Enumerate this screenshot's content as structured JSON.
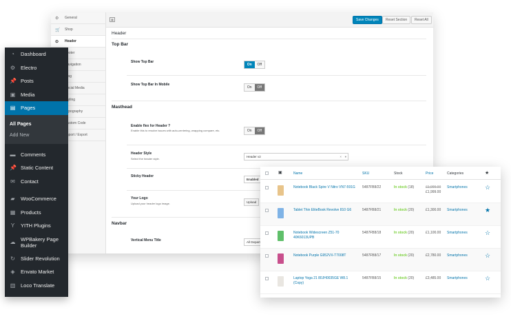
{
  "theme_options": {
    "nav": [
      {
        "icon": "gear-icon",
        "glyph": "⚙",
        "label": "General"
      },
      {
        "icon": "cart-icon",
        "glyph": "🛒",
        "label": "Shop"
      },
      {
        "icon": "header-icon",
        "glyph": "⊙",
        "label": "Header",
        "active": true
      },
      {
        "icon": "footer-icon",
        "glyph": "▢",
        "label": "Footer"
      },
      {
        "icon": "navigation-icon",
        "glyph": "≡",
        "label": "Navigation"
      },
      {
        "icon": "blog-icon",
        "glyph": "▤",
        "label": "Blog"
      },
      {
        "icon": "social-icon",
        "glyph": "◎",
        "label": "Social Media"
      },
      {
        "icon": "styling-icon",
        "glyph": "✎",
        "label": "Styling"
      },
      {
        "icon": "typography-icon",
        "glyph": "A",
        "label": "Typography"
      },
      {
        "icon": "code-icon",
        "glyph": "‹›",
        "label": "Custom Code"
      },
      {
        "icon": "import-icon",
        "glyph": "⇅",
        "label": "Import / Export"
      }
    ],
    "buttons": {
      "save": "Save Changes",
      "reset_section": "Reset Section",
      "reset_all": "Reset All"
    },
    "section_title": "Header",
    "top_bar": {
      "title": "Top Bar",
      "show_top_bar": {
        "label": "Show Top Bar",
        "on": "On",
        "off": "Off",
        "value": "On"
      },
      "show_top_bar_mobile": {
        "label": "Show Top Bar In Mobile",
        "on": "On",
        "off": "Off",
        "value": "Off"
      }
    },
    "masthead": {
      "title": "Masthead",
      "flex": {
        "label": "Enable flex for Header ?",
        "desc": "Enable this to resolve issues with auto-centering, wrapping compare, etc.",
        "on": "On",
        "off": "Off",
        "value": "Off"
      },
      "header_style": {
        "label": "Header Style",
        "desc": "Select the header style.",
        "value": "Header v2"
      },
      "sticky": {
        "label": "Sticky Header",
        "value": "Enabled"
      },
      "logo": {
        "label": "Your Logo",
        "desc": "Upload your header logo image.",
        "button": "Upload"
      }
    },
    "navbar": {
      "title": "Navbar",
      "menu_title": {
        "label": "Vertical Menu Title",
        "value": "All Departments"
      }
    }
  },
  "wp_menu": {
    "items": [
      {
        "icon": "dashboard-icon",
        "glyph": "◔",
        "label": "Dashboard"
      },
      {
        "icon": "electro-icon",
        "glyph": "⚙",
        "label": "Electro"
      },
      {
        "icon": "posts-icon",
        "glyph": "📌",
        "label": "Posts"
      },
      {
        "icon": "media-icon",
        "glyph": "▣",
        "label": "Media"
      },
      {
        "icon": "pages-icon",
        "glyph": "▤",
        "label": "Pages",
        "current": true
      }
    ],
    "pages_submenu": [
      "All Pages",
      "Add New"
    ],
    "items2": [
      {
        "icon": "comments-icon",
        "glyph": "▬",
        "label": "Comments"
      },
      {
        "icon": "pin-icon",
        "glyph": "📌",
        "label": "Static Content"
      },
      {
        "icon": "contact-icon",
        "glyph": "✉",
        "label": "Contact"
      }
    ],
    "items3": [
      {
        "icon": "woocommerce-icon",
        "glyph": "▰",
        "label": "WooCommerce"
      },
      {
        "icon": "products-icon",
        "glyph": "▦",
        "label": "Products"
      },
      {
        "icon": "yith-icon",
        "glyph": "Y",
        "label": "YITH Plugins"
      },
      {
        "icon": "wpbakery-icon",
        "glyph": "☁",
        "label": "WPBakery Page Builder",
        "tall": true
      },
      {
        "icon": "slider-icon",
        "glyph": "↻",
        "label": "Slider Revolution"
      },
      {
        "icon": "envato-icon",
        "glyph": "◈",
        "label": "Envato Market"
      },
      {
        "icon": "translate-icon",
        "glyph": "▥",
        "label": "Loco Translate"
      }
    ]
  },
  "products_table": {
    "headers": {
      "name": "Name",
      "sku": "SKU",
      "stock": "Stock",
      "price": "Price",
      "categories": "Categories",
      "featured": "★"
    },
    "rows": [
      {
        "name": "Notebook Black Spire V Nitro VN7-591G",
        "sku": "5487FB8/22",
        "stock_status": "In stock",
        "stock_qty": "(18)",
        "price_old": "£1,999.00",
        "price": "£1,999.00",
        "category": "Smartphones",
        "featured": false,
        "thumb_color": "#e8c48a"
      },
      {
        "name": "Tablet Thin EliteBook Revolve 810 G6",
        "sku": "5487FB8/21",
        "stock_status": "In stock",
        "stock_qty": "(20)",
        "price_old": "",
        "price": "£1,300.00",
        "category": "Smartphones",
        "featured": true,
        "thumb_color": "#7fb3e6"
      },
      {
        "name": "Notebook Widescreen Z51-70 40K6013UPB",
        "sku": "5487FB8/18",
        "stock_status": "In stock",
        "stock_qty": "(20)",
        "price_old": "",
        "price": "£1,100.00",
        "category": "Smartphones",
        "featured": false,
        "thumb_color": "#5fbf6a"
      },
      {
        "name": "Notebook Purple G952VX-T7008T",
        "sku": "5487FB8/17",
        "stock_status": "In stock",
        "stock_qty": "(20)",
        "price_old": "",
        "price": "£2,780.00",
        "category": "Smartphones",
        "featured": false,
        "thumb_color": "#c84f8c"
      },
      {
        "name": "Laptop Yoga 21 80JH0035GE W8.1 (Copy)",
        "sku": "5487FB8/15",
        "stock_status": "In stock",
        "stock_qty": "(20)",
        "price_old": "",
        "price": "£3,485.00",
        "category": "Smartphones",
        "featured": false,
        "thumb_color": "#e9e6e1"
      }
    ]
  }
}
